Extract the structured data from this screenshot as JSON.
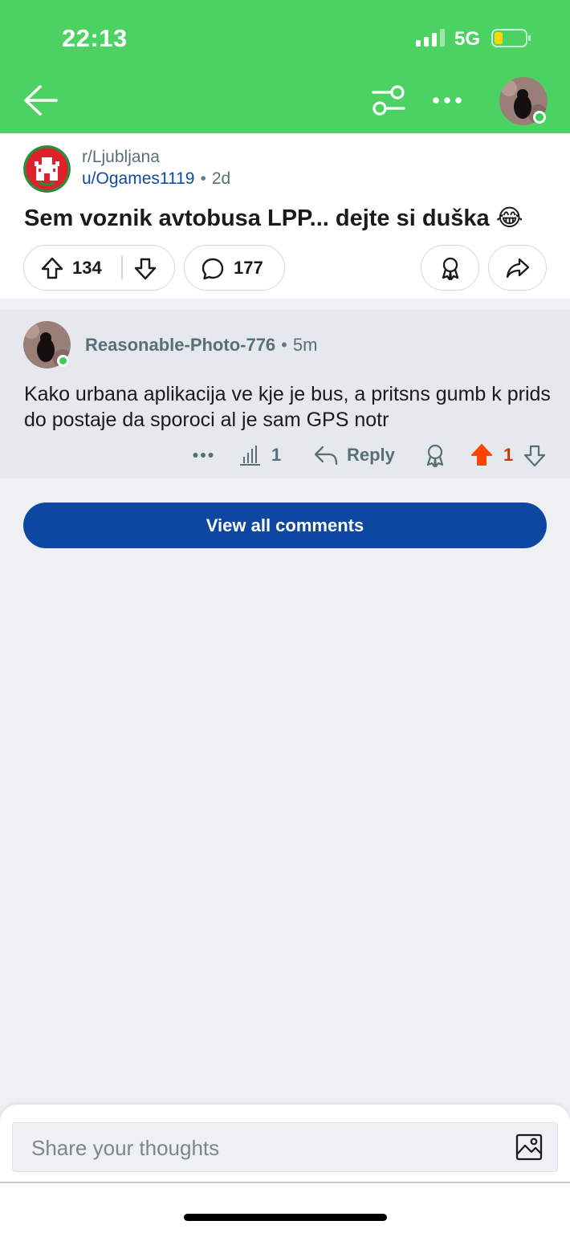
{
  "status_bar": {
    "time": "22:13",
    "network": "5G"
  },
  "post": {
    "subreddit": "r/Ljubljana",
    "author": "u/Ogames1119",
    "age": "2d",
    "title": "Sem voznik avtobusa LPP... dejte si duška 😂",
    "upvotes": "134",
    "comments": "177"
  },
  "comment": {
    "author": "Reasonable-Photo-776",
    "age": "5m",
    "body": "Kako urbana aplikacija ve kje je bus, a pritsns gumb k prids do postaje da sporoci al je sam GPS notr",
    "stats": "1",
    "reply_label": "Reply",
    "score": "1"
  },
  "view_all_label": "View all comments",
  "composer": {
    "placeholder": "Share your thoughts"
  },
  "colors": {
    "header": "#4cd263",
    "upvoted": "#ff4500",
    "button": "#0e47a1",
    "author_link": "#0f4c9e"
  }
}
